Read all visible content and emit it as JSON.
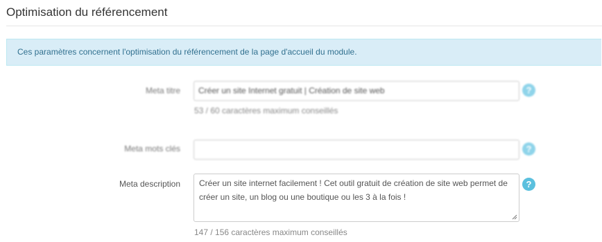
{
  "section": {
    "title": "Optimisation du référencement"
  },
  "info": {
    "text": "Ces paramètres concernent l'optimisation du référencement de la page d'accueil du module."
  },
  "fields": {
    "meta_title": {
      "label": "Meta titre",
      "value": "Créer un site Internet gratuit | Création de site web",
      "hint": "53 / 60 caractères maximum conseillés",
      "help_icon": "question-circle-icon"
    },
    "meta_keywords": {
      "label": "Meta mots clés",
      "value": "",
      "help_icon": "question-circle-icon"
    },
    "meta_description": {
      "label": "Meta description",
      "value": "Créer un site internet facilement ! Cet outil gratuit de création de site web permet de créer un site, un blog ou une boutique ou les 3 à la fois !",
      "hint": "147 / 156 caractères maximum conseillés",
      "help_icon": "question-circle-icon"
    }
  },
  "colors": {
    "info_background": "#d9edf7",
    "info_text": "#31708f",
    "help_icon": "#5bc0de"
  }
}
